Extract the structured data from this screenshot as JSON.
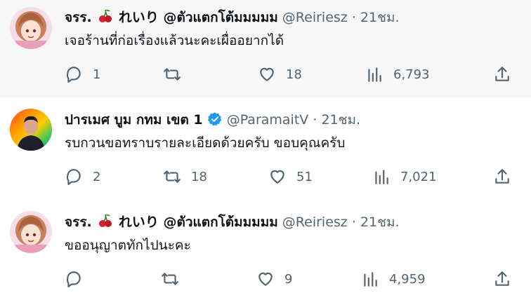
{
  "tweets": [
    {
      "name": "จรร.",
      "name_suffix": "れいり @ตัวแตกโต้มมมมม",
      "handle": "@Reiriesz",
      "dot": "·",
      "time": "21ชม.",
      "text": "เจอร้านที่ก่อเรื่องแล้วนะคะเผื่ออยากได้",
      "replies": "1",
      "retweets": "",
      "likes": "18",
      "views": "6,793"
    },
    {
      "name": "ปารเมศ บูม กทม เขต 1",
      "handle": "@ParamaitV",
      "dot": "·",
      "time": "21ชม.",
      "verified_color": "#1d9bf0",
      "text": "รบกวนขอทราบรายละเอียดด้วยครับ ขอบคุณครับ",
      "replies": "2",
      "retweets": "18",
      "likes": "51",
      "views": "7,021"
    },
    {
      "name": "จรร.",
      "name_suffix": "れいり @ตัวแตกโต้มมมมม",
      "handle": "@Reiriesz",
      "dot": "·",
      "time": "21ชม.",
      "text": "ขออนุญาตทักไปนะคะ",
      "replies": "",
      "retweets": "",
      "likes": "9",
      "views": "4,959"
    }
  ],
  "colors": {
    "text_primary": "#0f1419",
    "text_secondary": "#536471",
    "verified": "#1d9bf0",
    "thread_line": "#cfd9de"
  }
}
